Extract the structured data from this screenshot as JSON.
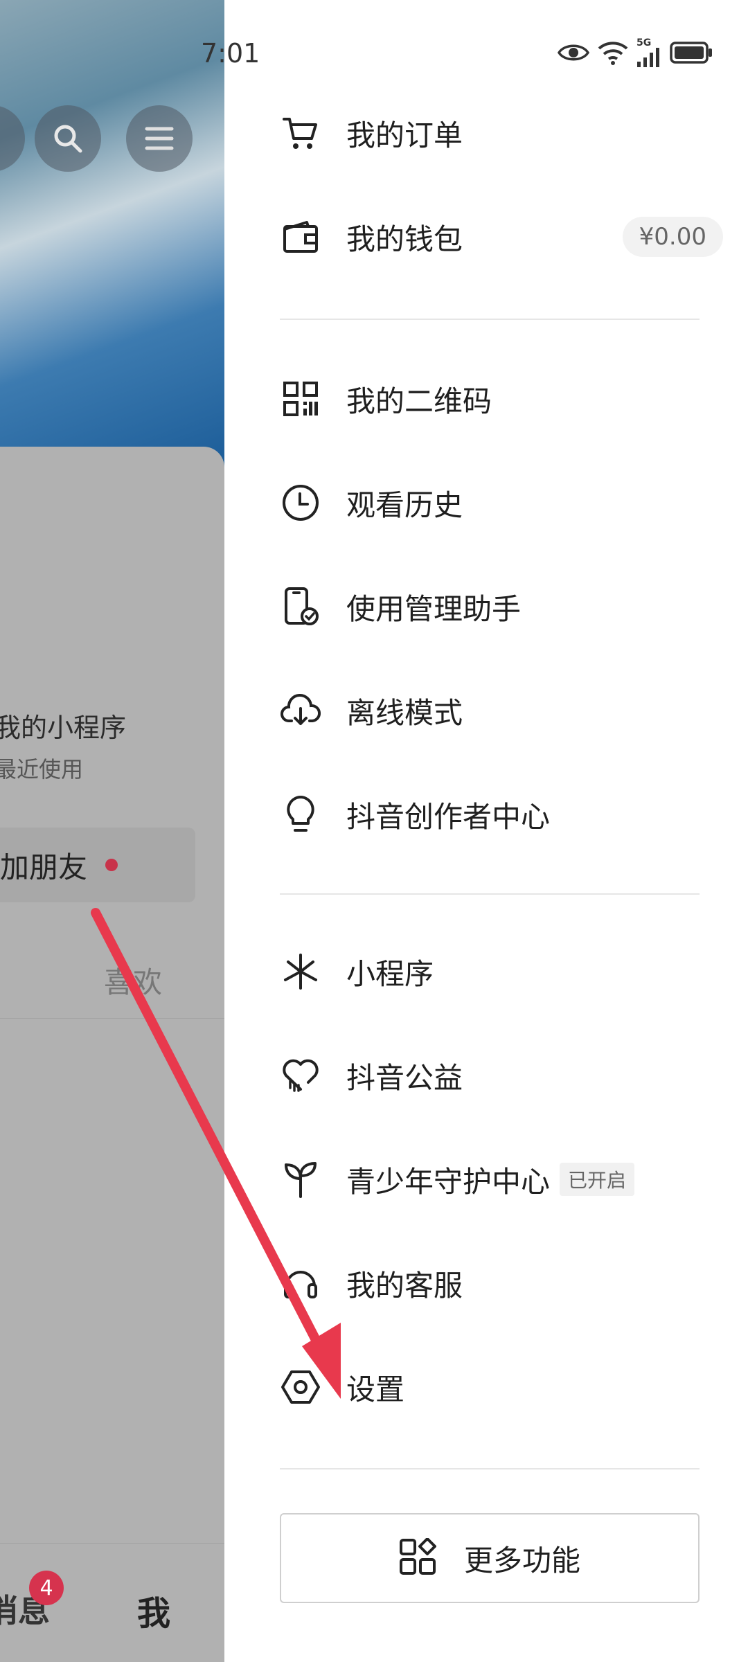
{
  "status_bar": {
    "time": "7:01",
    "network": "5G"
  },
  "background": {
    "mini_program_title": "我的小程序",
    "mini_program_subtitle": "最近使用",
    "add_friend_label": "加朋友",
    "like_tab_label": "喜欢",
    "nav_messages_label": "消息",
    "nav_messages_badge": "4",
    "nav_me_label": "我"
  },
  "drawer": {
    "items": [
      {
        "label": "我的订单",
        "icon": "cart-icon"
      },
      {
        "label": "我的钱包",
        "icon": "wallet-icon",
        "badge": "¥0.00"
      },
      {
        "label": "我的二维码",
        "icon": "qr-code-icon"
      },
      {
        "label": "观看历史",
        "icon": "clock-icon"
      },
      {
        "label": "使用管理助手",
        "icon": "phone-check-icon"
      },
      {
        "label": "离线模式",
        "icon": "cloud-download-icon"
      },
      {
        "label": "抖音创作者中心",
        "icon": "lightbulb-icon"
      },
      {
        "label": "小程序",
        "icon": "mini-program-icon"
      },
      {
        "label": "抖音公益",
        "icon": "heart-icon"
      },
      {
        "label": "青少年守护中心",
        "icon": "sprout-icon",
        "badge": "已开启"
      },
      {
        "label": "我的客服",
        "icon": "headset-icon"
      },
      {
        "label": "设置",
        "icon": "settings-hex-icon"
      }
    ],
    "more_button_label": "更多功能"
  },
  "annotation": {
    "arrow_color": "#e8394d"
  }
}
